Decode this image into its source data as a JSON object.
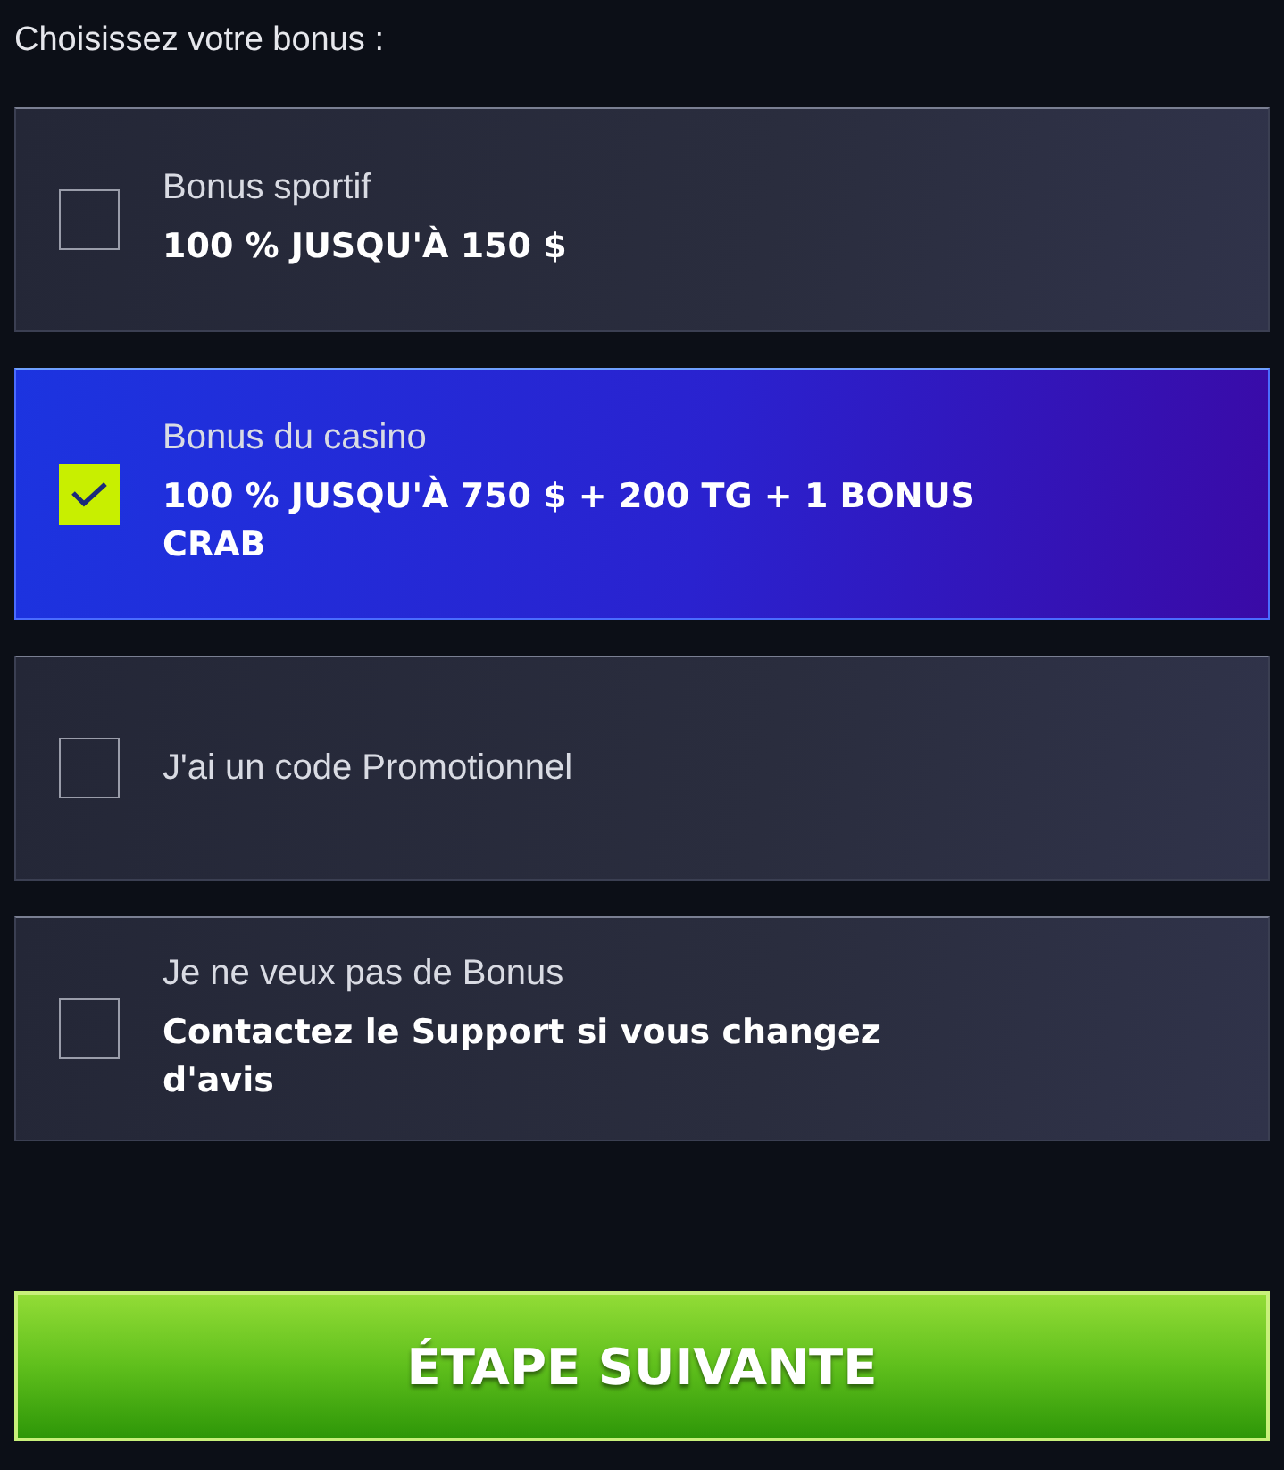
{
  "title": "Choisissez votre bonus :",
  "options": [
    {
      "label": "Bonus sportif",
      "detail": "100 % JUSQU'À 150 $",
      "selected": false
    },
    {
      "label": "Bonus du casino",
      "detail": "100 % JUSQU'À 750 $ + 200 TG + 1 BONUS CRAB",
      "selected": true
    },
    {
      "label": "J'ai un code Promotionnel",
      "selected": false
    },
    {
      "label": "Je ne veux pas de Bonus",
      "detail": "Contactez le Support si vous changez d'avis",
      "selected": false
    }
  ],
  "button": "ÉTAPE SUIVANTE"
}
